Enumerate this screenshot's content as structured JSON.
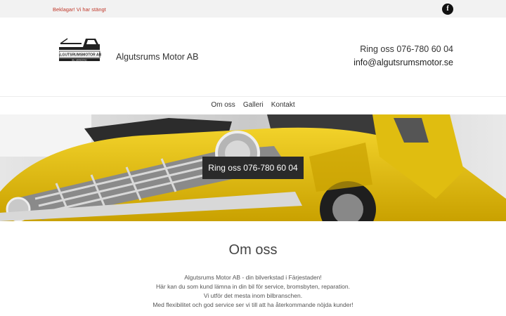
{
  "topbar": {
    "notice": "Beklagar! Vi har stängt",
    "facebook_glyph": "f",
    "notice_color": "#c0392b"
  },
  "header": {
    "logo_icon": "tow-truck-logo-icon",
    "logo_text": "ALGUTSRUMSMOTOR AB",
    "logo_subtext": "BIL VERKSTAD",
    "company_name": "Algutsrums Motor AB",
    "phone_label": "Ring oss",
    "phone_number": "076-780 60 04",
    "email": "info@algutsrumsmotor.se"
  },
  "nav": {
    "items": [
      {
        "label": "Om oss"
      },
      {
        "label": "Galleri"
      },
      {
        "label": "Kontakt"
      }
    ]
  },
  "hero": {
    "image": "yellow-vintage-pickup-truck-front",
    "cta_label": "Ring oss 076-780 60 04",
    "truck_color": "#e8c20f"
  },
  "about": {
    "title": "Om oss",
    "lines": [
      "Algutsrums Motor AB - din bilverkstad i Färjestaden!",
      "Här kan du som kund lämna in din bil för service, bromsbyten, reparation.",
      "Vi utför det mesta inom bilbranschen.",
      "Med flexibilitet och god service ser vi till att ha återkommande nöjda kunder!"
    ]
  }
}
